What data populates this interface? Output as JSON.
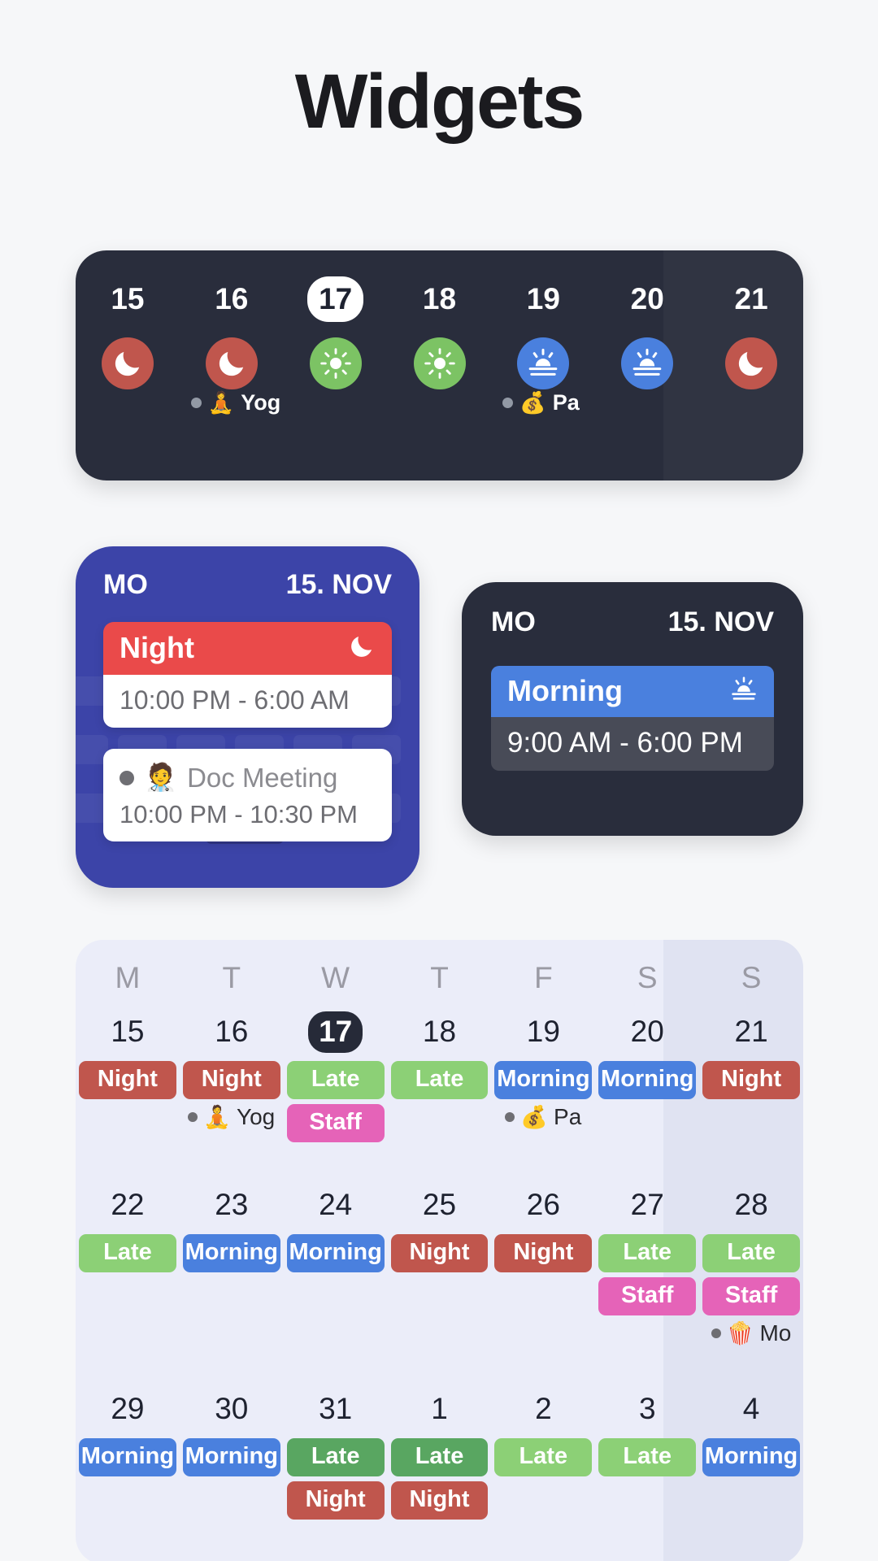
{
  "title": "Widgets",
  "colors": {
    "night": "#c0564d",
    "late": "#8cd076",
    "late_dark": "#59a661",
    "morning": "#4a80de",
    "staff": "#e563b8",
    "widget_dark": "#292d3c",
    "widget_blue": "#3c44a8",
    "month_bg": "#ebedf9"
  },
  "week_widget": {
    "days": [
      {
        "num": "15",
        "today": false,
        "shift": "night",
        "icon": "moon-icon"
      },
      {
        "num": "16",
        "today": false,
        "shift": "night",
        "icon": "moon-icon"
      },
      {
        "num": "17",
        "today": true,
        "shift": "late",
        "icon": "sun-icon"
      },
      {
        "num": "18",
        "today": false,
        "shift": "late",
        "icon": "sun-icon"
      },
      {
        "num": "19",
        "today": false,
        "shift": "morning",
        "icon": "sunrise-icon"
      },
      {
        "num": "20",
        "today": false,
        "shift": "morning",
        "icon": "sunrise-icon"
      },
      {
        "num": "21",
        "today": false,
        "shift": "night",
        "icon": "moon-icon"
      }
    ],
    "events": [
      {
        "day_index": 1,
        "emoji": "🧘",
        "label": "Yog"
      },
      {
        "day_index": 4,
        "emoji": "💰",
        "label": "Pa"
      }
    ]
  },
  "blue_day_widget": {
    "weekday": "MO",
    "date": "15. NOV",
    "shift": {
      "label": "Night",
      "icon": "moon-icon",
      "time": "10:00 PM - 6:00 AM",
      "color": "#ea4a4a"
    },
    "event": {
      "emoji": "🧑‍⚕️",
      "title": "Doc Meeting",
      "time": "10:00 PM - 10:30 PM"
    }
  },
  "dark_day_widget": {
    "weekday": "MO",
    "date": "15. NOV",
    "shift": {
      "label": "Morning",
      "icon": "sunrise-icon",
      "time": "9:00 AM - 6:00 PM",
      "color": "#4a80de"
    }
  },
  "month_widget": {
    "dow": [
      "M",
      "T",
      "W",
      "T",
      "F",
      "S",
      "S"
    ],
    "weeks": [
      {
        "days": [
          {
            "num": "15",
            "today": false,
            "chips": [
              {
                "label": "Night",
                "type": "night"
              }
            ],
            "events": []
          },
          {
            "num": "16",
            "today": false,
            "chips": [
              {
                "label": "Night",
                "type": "night"
              }
            ],
            "events": [
              {
                "emoji": "🧘",
                "label": "Yog"
              }
            ]
          },
          {
            "num": "17",
            "today": true,
            "chips": [
              {
                "label": "Late",
                "type": "late"
              },
              {
                "label": "Staff",
                "type": "staff"
              }
            ],
            "events": []
          },
          {
            "num": "18",
            "today": false,
            "chips": [
              {
                "label": "Late",
                "type": "late"
              }
            ],
            "events": []
          },
          {
            "num": "19",
            "today": false,
            "chips": [
              {
                "label": "Morning",
                "type": "morning"
              }
            ],
            "events": [
              {
                "emoji": "💰",
                "label": "Pa"
              }
            ]
          },
          {
            "num": "20",
            "today": false,
            "chips": [
              {
                "label": "Morning",
                "type": "morning"
              }
            ],
            "events": []
          },
          {
            "num": "21",
            "today": false,
            "chips": [
              {
                "label": "Night",
                "type": "night"
              }
            ],
            "events": []
          }
        ]
      },
      {
        "days": [
          {
            "num": "22",
            "today": false,
            "chips": [
              {
                "label": "Late",
                "type": "late"
              }
            ],
            "events": []
          },
          {
            "num": "23",
            "today": false,
            "chips": [
              {
                "label": "Morning",
                "type": "morning"
              }
            ],
            "events": []
          },
          {
            "num": "24",
            "today": false,
            "chips": [
              {
                "label": "Morning",
                "type": "morning"
              }
            ],
            "events": []
          },
          {
            "num": "25",
            "today": false,
            "chips": [
              {
                "label": "Night",
                "type": "night"
              }
            ],
            "events": []
          },
          {
            "num": "26",
            "today": false,
            "chips": [
              {
                "label": "Night",
                "type": "night"
              }
            ],
            "events": []
          },
          {
            "num": "27",
            "today": false,
            "chips": [
              {
                "label": "Late",
                "type": "late"
              },
              {
                "label": "Staff",
                "type": "staff"
              }
            ],
            "events": []
          },
          {
            "num": "28",
            "today": false,
            "chips": [
              {
                "label": "Late",
                "type": "late"
              },
              {
                "label": "Staff",
                "type": "staff"
              }
            ],
            "events": [
              {
                "emoji": "🍿",
                "label": "Mo"
              }
            ]
          }
        ]
      },
      {
        "days": [
          {
            "num": "29",
            "today": false,
            "chips": [
              {
                "label": "Morning",
                "type": "morning"
              }
            ],
            "events": []
          },
          {
            "num": "30",
            "today": false,
            "chips": [
              {
                "label": "Morning",
                "type": "morning"
              }
            ],
            "events": []
          },
          {
            "num": "31",
            "today": false,
            "chips": [
              {
                "label": "Late",
                "type": "late2"
              },
              {
                "label": "Night",
                "type": "night"
              }
            ],
            "events": []
          },
          {
            "num": "1",
            "today": false,
            "chips": [
              {
                "label": "Late",
                "type": "late2"
              },
              {
                "label": "Night",
                "type": "night"
              }
            ],
            "events": []
          },
          {
            "num": "2",
            "today": false,
            "chips": [
              {
                "label": "Late",
                "type": "late"
              }
            ],
            "events": []
          },
          {
            "num": "3",
            "today": false,
            "chips": [
              {
                "label": "Late",
                "type": "late"
              }
            ],
            "events": []
          },
          {
            "num": "4",
            "today": false,
            "chips": [
              {
                "label": "Morning",
                "type": "morning"
              }
            ],
            "events": []
          }
        ]
      }
    ]
  }
}
